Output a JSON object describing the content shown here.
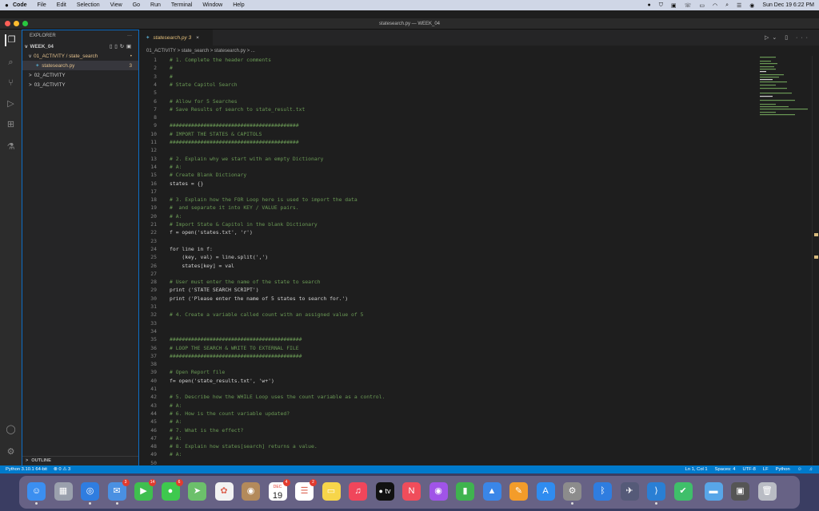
{
  "menubar": {
    "app_name": "Code",
    "items": [
      "File",
      "Edit",
      "Selection",
      "View",
      "Go",
      "Run",
      "Terminal",
      "Window",
      "Help"
    ],
    "clock": "Sun Dec 19  6:22 PM"
  },
  "window": {
    "title": "statesearch.py — WEEK_04"
  },
  "sidebar": {
    "title": "EXPLORER",
    "workspace": "WEEK_04",
    "tree": [
      {
        "label": "01_ACTIVITY / state_search",
        "badge": "•",
        "indent": 1,
        "chevron": "v",
        "color": "#e2c08d"
      },
      {
        "label": "statesearch.py",
        "badge": "3",
        "indent": 2,
        "chevron": "",
        "color": "#e2c08d",
        "active": true
      },
      {
        "label": "02_ACTIVITY",
        "badge": "",
        "indent": 1,
        "chevron": ">",
        "color": "#cccccc"
      },
      {
        "label": "03_ACTIVITY",
        "badge": "",
        "indent": 1,
        "chevron": ">",
        "color": "#cccccc"
      }
    ],
    "outline_label": "OUTLINE"
  },
  "editor": {
    "tab_label": "statesearch.py 3",
    "breadcrumb": "01_ACTIVITY > state_search > statesearch.py > ...",
    "lines": [
      {
        "n": "1",
        "t": "# 1. Complete the header comments",
        "k": "c"
      },
      {
        "n": "2",
        "t": "#",
        "k": "c"
      },
      {
        "n": "3",
        "t": "#",
        "k": "c"
      },
      {
        "n": "4",
        "t": "# State Capitol Search",
        "k": "c"
      },
      {
        "n": "5",
        "t": "",
        "k": "c"
      },
      {
        "n": "6",
        "t": "# Allow for 5 Searches",
        "k": "c"
      },
      {
        "n": "7",
        "t": "# Save Results of search to state_result.txt",
        "k": "c"
      },
      {
        "n": "8",
        "t": "",
        "k": "c"
      },
      {
        "n": "9",
        "t": "##########################################",
        "k": "c"
      },
      {
        "n": "10",
        "t": "# IMPORT THE STATES & CAPITOLS",
        "k": "c"
      },
      {
        "n": "11",
        "t": "##########################################",
        "k": "c"
      },
      {
        "n": "12",
        "t": "",
        "k": "c"
      },
      {
        "n": "13",
        "t": "# 2. Explain why we start with an empty Dictionary",
        "k": "c"
      },
      {
        "n": "14",
        "t": "# A:",
        "k": "c"
      },
      {
        "n": "15",
        "t": "# Create Blank Dictionary",
        "k": "c"
      },
      {
        "n": "16",
        "t": "states = {}",
        "k": "p"
      },
      {
        "n": "17",
        "t": "",
        "k": "c"
      },
      {
        "n": "18",
        "t": "# 3. Explain how the FOR Loop here is used to import the data",
        "k": "c"
      },
      {
        "n": "19",
        "t": "#  and separate it into KEY / VALUE pairs.",
        "k": "c"
      },
      {
        "n": "20",
        "t": "# A:",
        "k": "c"
      },
      {
        "n": "21",
        "t": "# Import State & Capitol in the blank Dictionary",
        "k": "c"
      },
      {
        "n": "22",
        "t": "f = open('states.txt', 'r')",
        "k": "p"
      },
      {
        "n": "23",
        "t": "",
        "k": "c"
      },
      {
        "n": "24",
        "t": "for line in f:",
        "k": "p"
      },
      {
        "n": "25",
        "t": "    (key, val) = line.split(',')",
        "k": "p"
      },
      {
        "n": "26",
        "t": "    states[key] = val",
        "k": "p"
      },
      {
        "n": "27",
        "t": "",
        "k": "c"
      },
      {
        "n": "28",
        "t": "# User must enter the name of the state to search",
        "k": "c"
      },
      {
        "n": "29",
        "t": "print ('STATE SEARCH SCRIPT')",
        "k": "p"
      },
      {
        "n": "30",
        "t": "print ('Please enter the name of 5 states to search for.')",
        "k": "p"
      },
      {
        "n": "31",
        "t": "",
        "k": "c"
      },
      {
        "n": "32",
        "t": "# 4. Create a variable called count with an assigned value of 5",
        "k": "c"
      },
      {
        "n": "33",
        "t": "",
        "k": "c"
      },
      {
        "n": "34",
        "t": "",
        "k": "c"
      },
      {
        "n": "35",
        "t": "###########################################",
        "k": "c"
      },
      {
        "n": "36",
        "t": "# LOOP THE SEARCH & WRITE TO EXTERNAL FILE",
        "k": "c"
      },
      {
        "n": "37",
        "t": "###########################################",
        "k": "c"
      },
      {
        "n": "38",
        "t": "",
        "k": "c"
      },
      {
        "n": "39",
        "t": "# Open Report file",
        "k": "c"
      },
      {
        "n": "40",
        "t": "f= open('state_results.txt', 'w+')",
        "k": "p"
      },
      {
        "n": "41",
        "t": "",
        "k": "c"
      },
      {
        "n": "42",
        "t": "# 5. Describe how the WHILE Loop uses the count variable as a control.",
        "k": "c"
      },
      {
        "n": "43",
        "t": "# A:",
        "k": "c"
      },
      {
        "n": "44",
        "t": "# 6. How is the count variable updated?",
        "k": "c"
      },
      {
        "n": "45",
        "t": "# A:",
        "k": "c"
      },
      {
        "n": "46",
        "t": "# 7. What is the effect?",
        "k": "c"
      },
      {
        "n": "47",
        "t": "# A:",
        "k": "c"
      },
      {
        "n": "48",
        "t": "# 8. Explain how states[search] returns a value.",
        "k": "c"
      },
      {
        "n": "49",
        "t": "# A:",
        "k": "c"
      },
      {
        "n": "50",
        "t": "",
        "k": "c"
      }
    ]
  },
  "statusbar": {
    "python": "Python 3.10.1 64-bit",
    "problems": "⊗ 0 ⚠ 3",
    "position": "Ln 1, Col 1",
    "spaces": "Spaces: 4",
    "encoding": "UTF-8",
    "eol": "LF",
    "language": "Python"
  },
  "dock": {
    "calendar_month": "DEC",
    "calendar_day": "19",
    "tv_label": "tv",
    "icons": [
      {
        "name": "finder-icon",
        "bg": "#3b8ff0",
        "glyph": "☺",
        "badge": ""
      },
      {
        "name": "launchpad-icon",
        "bg": "#9aa0ad",
        "glyph": "▦",
        "badge": ""
      },
      {
        "name": "safari-icon",
        "bg": "#2f7de0",
        "glyph": "◎",
        "badge": ""
      },
      {
        "name": "mail-icon",
        "bg": "#4a90e2",
        "glyph": "✉",
        "badge": "3"
      },
      {
        "name": "facetime-icon",
        "bg": "#3fbf4f",
        "glyph": "▶",
        "badge": "14"
      },
      {
        "name": "messages-icon",
        "bg": "#3ec94e",
        "glyph": "●",
        "badge": "6"
      },
      {
        "name": "maps-icon",
        "bg": "#6cc06b",
        "glyph": "➤",
        "badge": ""
      },
      {
        "name": "photos-icon",
        "bg": "#f2f2f2",
        "glyph": "✿",
        "badge": ""
      },
      {
        "name": "contacts-icon",
        "bg": "#b38a5b",
        "glyph": "◉",
        "badge": ""
      },
      {
        "name": "calendar-icon",
        "bg": "#ffffff",
        "glyph": "",
        "badge": "4"
      },
      {
        "name": "reminders-icon",
        "bg": "#ffffff",
        "glyph": "☰",
        "badge": "2"
      },
      {
        "name": "notes-icon",
        "bg": "#f7d54a",
        "glyph": "▭",
        "badge": ""
      },
      {
        "name": "music-icon",
        "bg": "#f0465b",
        "glyph": "♫",
        "badge": ""
      },
      {
        "name": "tv-icon",
        "bg": "#111111",
        "glyph": "",
        "badge": ""
      },
      {
        "name": "news-icon",
        "bg": "#f04d5b",
        "glyph": "N",
        "badge": ""
      },
      {
        "name": "podcasts-icon",
        "bg": "#a054e8",
        "glyph": "◉",
        "badge": ""
      },
      {
        "name": "numbers-icon",
        "bg": "#3fb34f",
        "glyph": "▮",
        "badge": ""
      },
      {
        "name": "keynote-icon",
        "bg": "#3a86e8",
        "glyph": "▲",
        "badge": ""
      },
      {
        "name": "pages-icon",
        "bg": "#f39c2a",
        "glyph": "✎",
        "badge": ""
      },
      {
        "name": "app-store-icon",
        "bg": "#2f8cf0",
        "glyph": "A",
        "badge": ""
      },
      {
        "name": "system-preferences-icon",
        "bg": "#8c8c8c",
        "glyph": "⚙",
        "badge": ""
      },
      {
        "name": "bluetooth-icon",
        "bg": "#2f7de0",
        "glyph": "ᛒ",
        "badge": ""
      },
      {
        "name": "rocket-icon",
        "bg": "#555a78",
        "glyph": "✈",
        "badge": ""
      },
      {
        "name": "vscode-icon",
        "bg": "#2a7fd4",
        "glyph": "⟩",
        "badge": ""
      },
      {
        "name": "security-app-icon",
        "bg": "#3fbf6a",
        "glyph": "✔",
        "badge": ""
      },
      {
        "name": "folder-icon",
        "bg": "#58a6e8",
        "glyph": "▬",
        "badge": ""
      },
      {
        "name": "screenshot-icon",
        "bg": "#555",
        "glyph": "▣",
        "badge": ""
      },
      {
        "name": "trash-icon",
        "bg": "#b9bcc4",
        "glyph": "🗑",
        "badge": ""
      }
    ]
  }
}
